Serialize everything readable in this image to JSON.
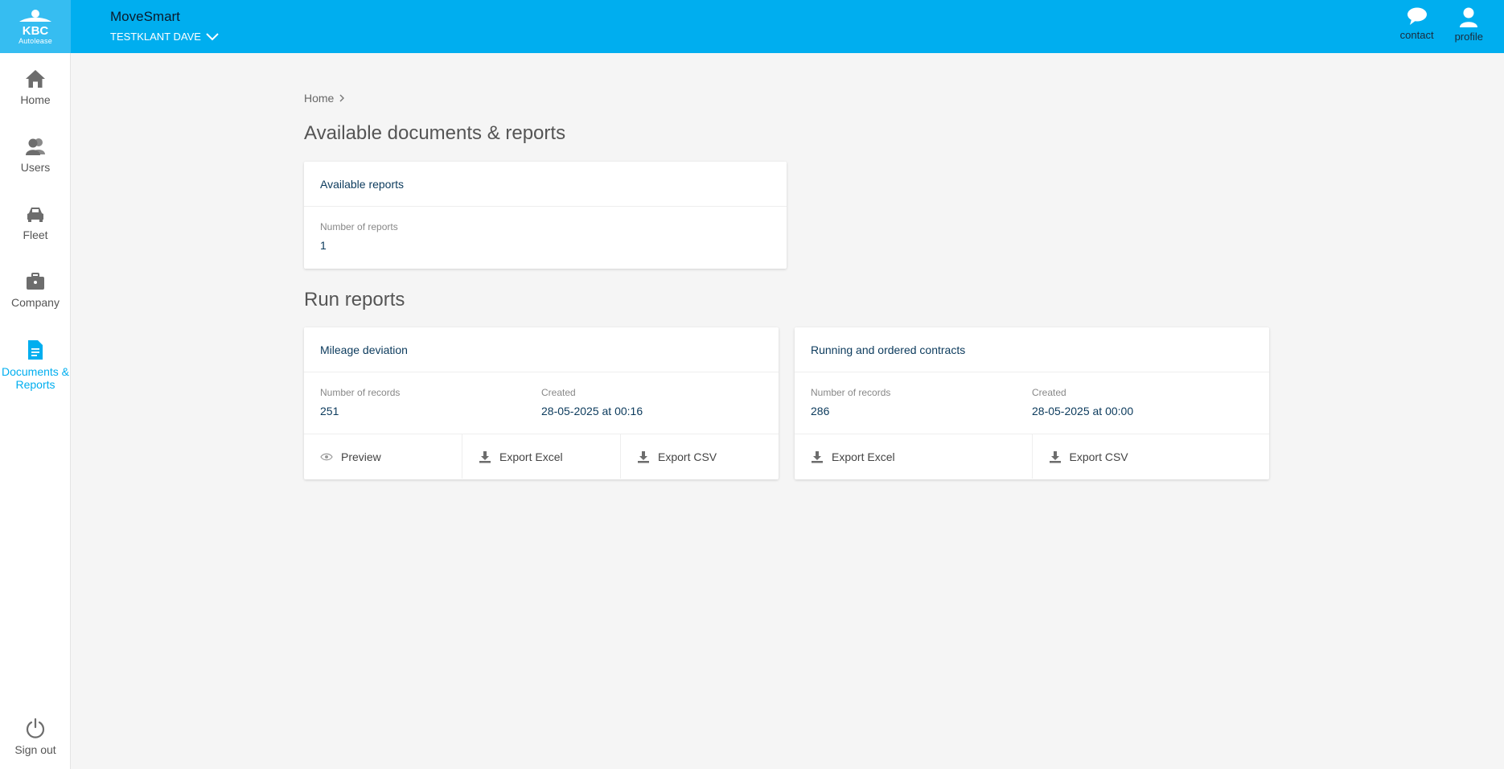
{
  "brand": {
    "logo_text": "KBC",
    "logo_sub": "Autolease",
    "app_title": "MoveSmart",
    "client_name": "TESTKLANT DAVE"
  },
  "top_actions": [
    {
      "label": "contact",
      "icon": "chat-bubble-icon"
    },
    {
      "label": "profile",
      "icon": "user-icon"
    }
  ],
  "sidebar": {
    "items": [
      {
        "label": "Home",
        "icon": "home-icon"
      },
      {
        "label": "Users",
        "icon": "users-icon"
      },
      {
        "label": "Fleet",
        "icon": "car-icon"
      },
      {
        "label": "Company",
        "icon": "briefcase-icon"
      },
      {
        "label": "Documents & Reports",
        "icon": "document-icon",
        "active": true
      }
    ],
    "sign_out": {
      "label": "Sign out",
      "icon": "power-icon"
    }
  },
  "breadcrumb": {
    "home": "Home"
  },
  "available": {
    "heading": "Available documents & reports",
    "card": {
      "title": "Available reports",
      "label": "Number of reports",
      "value": "1"
    }
  },
  "run_reports": {
    "heading": "Run reports",
    "cards": [
      {
        "title": "Mileage deviation",
        "records_label": "Number of records",
        "records_value": "251",
        "created_label": "Created",
        "created_value": "28-05-2025 at 00:16",
        "actions": [
          {
            "label": "Preview",
            "icon": "eye-icon"
          },
          {
            "label": "Export Excel",
            "icon": "download-icon"
          },
          {
            "label": "Export CSV",
            "icon": "download-icon"
          }
        ]
      },
      {
        "title": "Running and ordered contracts",
        "records_label": "Number of records",
        "records_value": "286",
        "created_label": "Created",
        "created_value": "28-05-2025 at 00:00",
        "actions": [
          {
            "label": "Export Excel",
            "icon": "download-icon"
          },
          {
            "label": "Export CSV",
            "icon": "download-icon"
          }
        ]
      }
    ]
  },
  "colors": {
    "primary": "#00aeef",
    "logo_bg": "#36bdf1",
    "text_dark": "#0b3a5c",
    "background": "#f5f5f5"
  }
}
